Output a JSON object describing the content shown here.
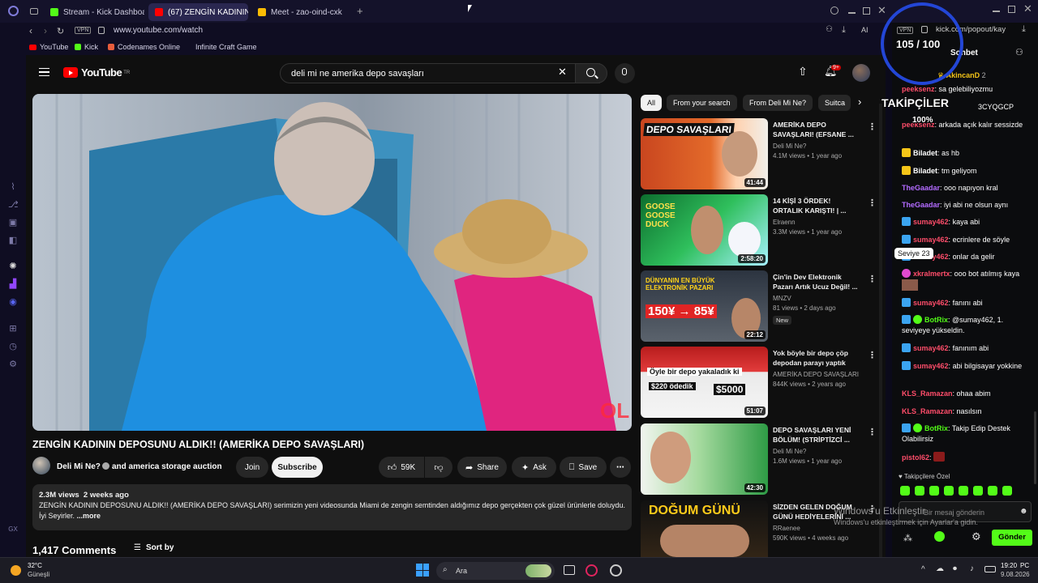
{
  "browser": {
    "tabs": [
      {
        "title": "Stream - Kick Dashboard",
        "color": "#53fc18"
      },
      {
        "title": "(67) ZENGİN KADININ D",
        "color": "#ff0000"
      },
      {
        "title": "Meet - zao-oind-cxk",
        "color": "#fbbc04"
      }
    ],
    "url": "www.youtube.com/watch",
    "vpn": "VPN",
    "ai": "AI",
    "bookmarks": [
      "YouTube",
      "Kick",
      "Codenames Online",
      "Infinite Craft Game"
    ]
  },
  "youtube": {
    "logo": "YouTube",
    "country": "TR",
    "search_query": "deli mi ne amerika depo savaşları",
    "notification_count": "9+",
    "video_title": "ZENGİN KADININ DEPOSUNU ALDIK!! (AMERİKA DEPO SAVAŞLARI)",
    "channel": "Deli Mi Ne?",
    "collab": "and america storage auction",
    "join_label": "Join",
    "subscribe_label": "Subscribe",
    "likes": "59K",
    "share_label": "Share",
    "ask_label": "Ask",
    "save_label": "Save",
    "views": "2.3M views",
    "age": "2 weeks ago",
    "description": "ZENGİN KADININ DEPOSUNU ALDIK!! (AMERİKA DEPO SAVAŞLARI) serimizin yeni videosunda Miami de zengin semtinden aldığımız depo gerçekten çok güzel ürünlerle doluydu. İyi Seyirler.",
    "more_label": "...more",
    "comments_count": "1,417 Comments",
    "sort_label": "Sort by",
    "chips": [
      "All",
      "From your search",
      "From Deli Mi Ne?",
      "Suitca"
    ],
    "related": [
      {
        "title": "AMERİKA DEPO SAVAŞLARI! (EFSANE ...",
        "channel": "Deli Mi Ne?",
        "meta": "4.1M views • 1 year ago",
        "duration": "41:44",
        "thumb_text": "DEPO SAVAŞLARI",
        "new": ""
      },
      {
        "title": "14 KİŞİ 3 ÖRDEK! ORTALIK KARIŞTI! | ...",
        "channel": "Elraenn",
        "meta": "3.3M views • 1 year ago",
        "duration": "2:58:20",
        "thumb_text": "GOOSE GOOSE DUCK",
        "new": ""
      },
      {
        "title": "Çin'in Dev Elektronik Pazarı Artık Ucuz Değil! ...",
        "channel": "MNZV",
        "meta": "81 views • 2 days ago",
        "duration": "22:12",
        "thumb_text": "DÜNYANIN EN BÜYÜK ELEKTRONİK PAZARI",
        "thumb_sub": "150¥ → 85¥",
        "new": "New"
      },
      {
        "title": "Yok böyle bir depo çöp depodan parayı yaptık",
        "channel": "AMERİKA DEPO SAVAŞLARI",
        "meta": "844K views • 2 years ago",
        "duration": "51:07",
        "thumb_text": "Öyle bir depo yakaladık ki",
        "thumb_sub": "$220 ödedik",
        "thumb_sub2": "$5000",
        "new": ""
      },
      {
        "title": "DEPO SAVAŞLARI YENİ BÖLÜM! (STRİPTİZCİ ...",
        "channel": "Deli Mi Ne?",
        "meta": "1.6M views • 1 year ago",
        "duration": "42:30",
        "thumb_text": "",
        "new": ""
      },
      {
        "title": "SİZDEN GELEN DOĞUM GÜNÜ HEDİYELERİNİ ...",
        "channel": "RRaenee",
        "meta": "590K views • 4 weeks ago",
        "duration": "",
        "thumb_text": "DOĞUM GÜNÜ",
        "new": ""
      }
    ]
  },
  "overlay": {
    "followers": "105 / 100",
    "label": "TAKİPÇİLER",
    "percent": "100%"
  },
  "kick": {
    "url": "kick.com/popout/kay",
    "tab_label": "Sohbet",
    "pinned_user": "AkincanD",
    "pinned_count": "2",
    "tooltip": "Seviye 23",
    "messages": [
      {
        "user": "peeksenz",
        "text": "sa gelebiliyozmu",
        "color": "#ff4d6a"
      },
      {
        "user": "",
        "text": "3CYQGCP",
        "color": "#ff4d6a"
      },
      {
        "user": "peeksenz",
        "text": "arkada açık kalır sessizde",
        "color": "#ff4d6a"
      },
      {
        "user": "Biladet",
        "text": "as hb",
        "color": "#ffffff"
      },
      {
        "user": "Biladet",
        "text": "tm geliyom",
        "color": "#ffffff"
      },
      {
        "user": "TheGaadar",
        "text": "ooo napıyon kral",
        "color": "#b36bff"
      },
      {
        "user": "TheGaadar",
        "text": "iyi abi ne olsun aynı",
        "color": "#b36bff"
      },
      {
        "user": "sumay462",
        "text": "kaya abi",
        "color": "#ff4d6a"
      },
      {
        "user": "sumay462",
        "text": "ecrinlere de söyle",
        "color": "#ff4d6a"
      },
      {
        "user": "sumay462",
        "text": "onlar da gelir",
        "color": "#ff4d6a"
      },
      {
        "user": "xkralmertx",
        "text": "ooo bot atılmış kaya",
        "color": "#ff4d6a"
      },
      {
        "user": "sumay462",
        "text": "fanını abi",
        "color": "#ff4d6a"
      },
      {
        "user": "BotRix",
        "text": "@sumay462, 1. seviyeye yükseldin.",
        "color": "#53fc18"
      },
      {
        "user": "sumay462",
        "text": "fanınım abi",
        "color": "#ff4d6a"
      },
      {
        "user": "sumay462",
        "text": "abi bilgisayar yokkine",
        "color": "#ff4d6a"
      },
      {
        "user": "KLS_Ramazan",
        "text": "ohaa abim",
        "color": "#ff4d6a"
      },
      {
        "user": "KLS_Ramazan",
        "text": "nasılsın",
        "color": "#ff4d6a"
      },
      {
        "user": "BotRix",
        "text": "Takip Edip Destek Olabilirsiz",
        "color": "#53fc18"
      },
      {
        "user": "pistol62",
        "text": "",
        "color": "#ff4d6a"
      }
    ],
    "followers_special": "Takipçilere Özel",
    "input_placeholder": "Bir mesaj gönderin",
    "send_label": "Gönder"
  },
  "watermark": {
    "line1": "Windows'u Etkinleştir",
    "line2": "Windows'u etkinleştirmek için Ayarlar'a gidin."
  },
  "taskbar": {
    "temp": "32°C",
    "weather": "Güneşli",
    "search_label": "Ara",
    "time": "19:20",
    "date": "9.08.2026",
    "lang": "PC"
  },
  "colors": {
    "kick_green": "#53fc18",
    "yt_red": "#ff0000",
    "overlay_blue": "#2346d6"
  }
}
